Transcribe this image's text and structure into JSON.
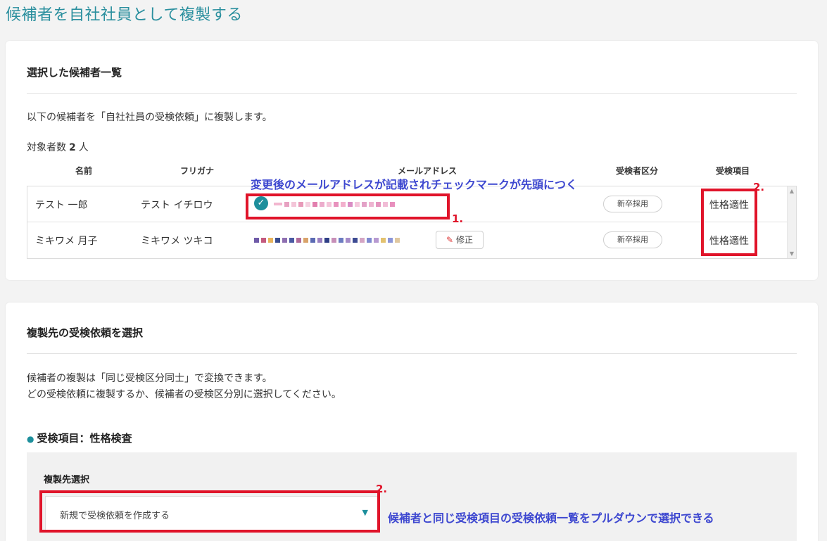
{
  "page": {
    "title": "候補者を自社社員として複製する"
  },
  "selected_section": {
    "title": "選択した候補者一覧",
    "description": "以下の候補者を「自社社員の受検依頼」に複製します。",
    "count_label": "対象者数",
    "count_value": "2",
    "count_unit": "人",
    "columns": [
      "名前",
      "フリガナ",
      "メールアドレス",
      "受検者区分",
      "受検項目"
    ],
    "rows": [
      {
        "name": "テスト 一郎",
        "furigana": "テスト イチロウ",
        "category": "新卒採用",
        "test_item": "性格適性",
        "email_verified": true
      },
      {
        "name": "ミキワメ 月子",
        "furigana": "ミキワメ ツキコ",
        "category": "新卒採用",
        "test_item": "性格適性",
        "edit_label": "修正"
      }
    ]
  },
  "copy_section": {
    "title": "複製先の受検依頼を選択",
    "description_line1": "候補者の複製は「同じ受検区分同士」で変換できます。",
    "description_line2": "どの受検依頼に複製するか、候補者の受検区分別に選択してください。",
    "item_heading": "受検項目：性格検査",
    "select_label": "複製先選択",
    "select_value": "新規で受検依頼を作成する"
  },
  "annotations": {
    "a1_text": "変更後のメールアドレスが記載されチェックマークが先頭につく",
    "a1_num": "1.",
    "a2_num": "2.",
    "a3_num": "2.",
    "a3_text": "候補者と同じ受検項目の受検依頼一覧をプルダウンで選択できる"
  },
  "colors": {
    "accent": "#1d8f9c",
    "annotation_red": "#e0142a",
    "annotation_blue": "#3e48d0"
  }
}
